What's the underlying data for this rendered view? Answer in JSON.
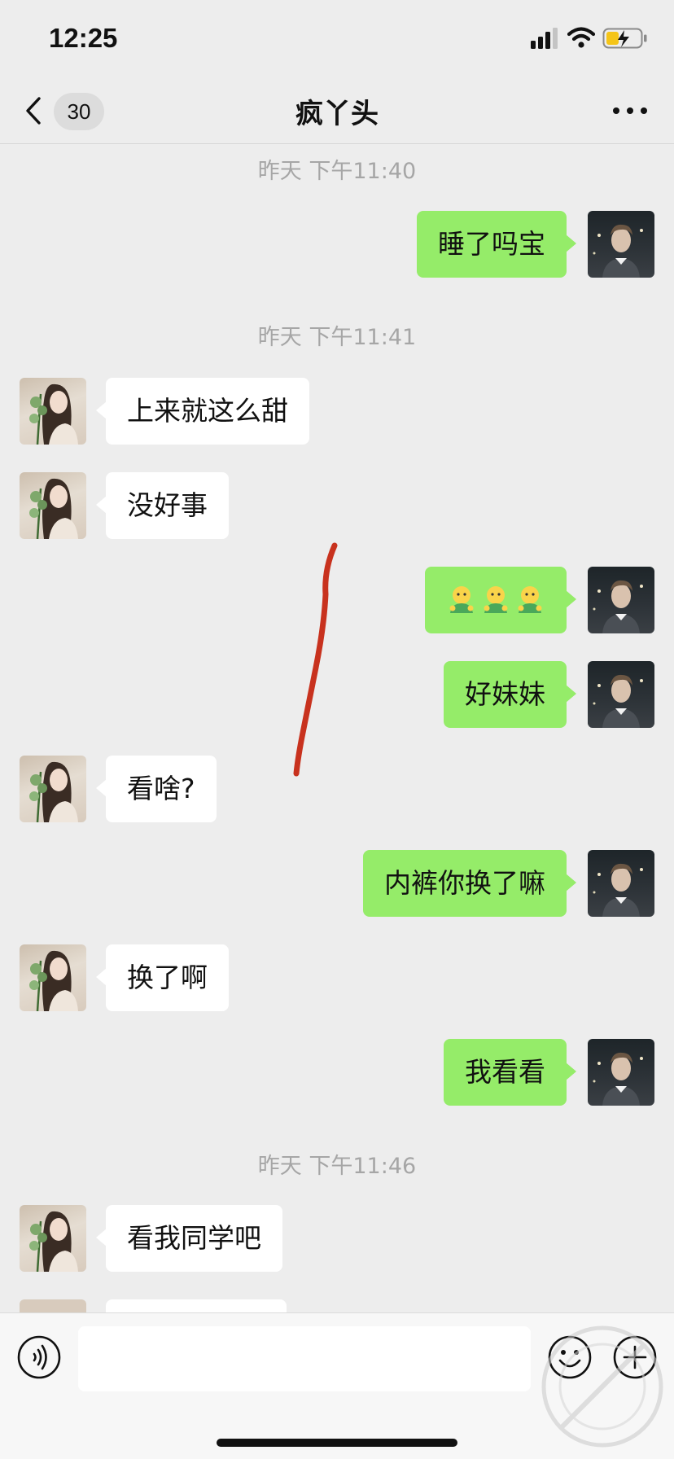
{
  "status_bar": {
    "time": "12:25"
  },
  "nav": {
    "unread_count": "30",
    "title": "疯丫头"
  },
  "timestamps": [
    "昨天 下午11:40",
    "昨天 下午11:41",
    "昨天 下午11:46"
  ],
  "messages": [
    {
      "from": "me",
      "text": "睡了吗宝"
    },
    {
      "from": "her",
      "text": "上来就这么甜"
    },
    {
      "from": "her",
      "text": "没好事"
    },
    {
      "from": "me",
      "text": "",
      "emoji": "shy-face-emoji x3"
    },
    {
      "from": "me",
      "text": "好妹妹"
    },
    {
      "from": "her",
      "text": "看啥?"
    },
    {
      "from": "me",
      "text": "内裤你换了嘛"
    },
    {
      "from": "her",
      "text": "换了啊"
    },
    {
      "from": "me",
      "text": "我看看"
    },
    {
      "from": "her",
      "text": "看我同学吧"
    }
  ],
  "input": {
    "placeholder": ""
  },
  "colors": {
    "bubble_out": "#95ec69",
    "bubble_in": "#ffffff",
    "background": "#ededed",
    "annotation": "#c8321e"
  }
}
